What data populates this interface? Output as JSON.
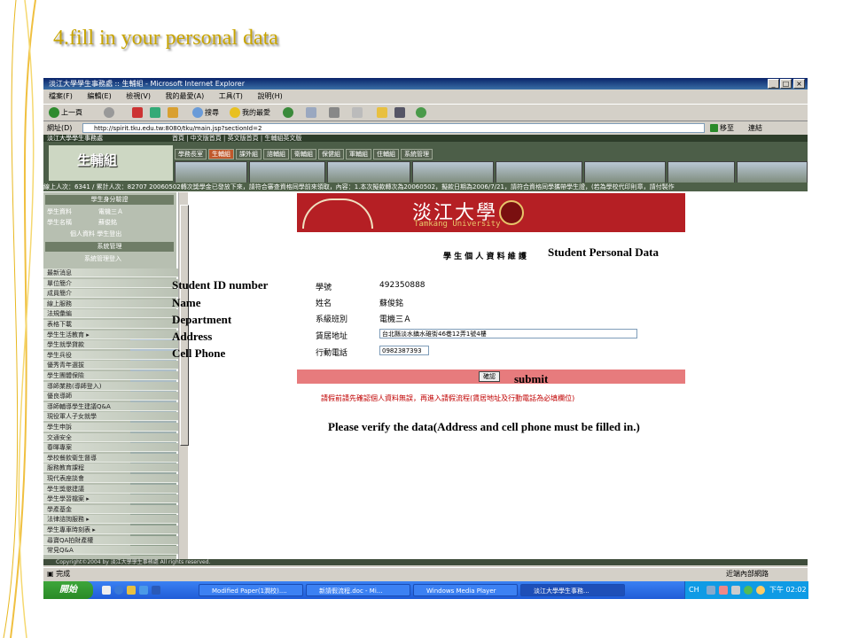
{
  "slide": {
    "title": "4.fill in your personal data"
  },
  "browser": {
    "window_title": "淡江大學學生事務處 :: 生輔組 - Microsoft Internet Explorer",
    "menu": [
      "檔案(F)",
      "編輯(E)",
      "檢視(V)",
      "我的最愛(A)",
      "工具(T)",
      "說明(H)"
    ],
    "toolbar": {
      "back": "上一頁",
      "search": "搜尋",
      "favorites": "我的最愛"
    },
    "address_label": "網址(D)",
    "url": "http://spirit.tku.edu.tw:8080/tku/main.jsp?sectionId=2",
    "go_label": "移至",
    "links_label": "連結",
    "status_left": "完成",
    "status_right": "近端內部網路"
  },
  "site": {
    "logo_text": "生輔組",
    "header_title": "淡江大學學生事務處",
    "nav_links": "首頁 | 中文版首頁 | 英文版首頁 | 生輔組英文版",
    "tabs": [
      "學務長室",
      "生輔組",
      "課外組",
      "諮輔組",
      "衛輔組",
      "保健組",
      "軍輔組",
      "住輔組",
      "系統管理"
    ],
    "ticker": "線上人次：6341 / 累計人次：82707    20060502轉次獎學金已發放下來，請符合審查資格同學前來領取，內容：1.本次擬款轉次為20060502，擬款日期為2006/7/21，請符合資格同學攜帶學生證，(若為學校代印則章，請付製作",
    "copyright": "Copyright©2004 by 淡江大學學生事務處 All rights reserved."
  },
  "sidebar": {
    "identity_header": "學生身分驗證",
    "student_info_label": "學生資料",
    "student_info_value": "電機三Ａ",
    "student_name_label": "學生名稱",
    "student_name_value": "蘇俊銘",
    "links": "個人資料 學生登出",
    "admin_header": "系統管理",
    "admin_link": "系統管理登入",
    "menu": [
      "最新消息",
      "單位簡介",
      "成員簡介",
      "線上服務",
      "法規彙編",
      "表格下載",
      "學生生活教育 ▸",
      "學生就學貸款",
      "學生兵役",
      "優秀青年選拔",
      "學生團體保險",
      "導師業務(導師登入)",
      "優良導師",
      "導師輔導學生建議Q&A",
      "現役軍人子女就學",
      "學生申訴",
      "交通安全",
      "春暉專案",
      "學校餐飲衛生督導",
      "服務教育課程",
      "現代表座談會",
      "學生獎懲建議",
      "學生學習檔案 ▸",
      "學產基金",
      "法律諮詢服務 ▸",
      "學生專車時刻表 ▸",
      "尋寶QA拍財產權",
      "常見Q&A"
    ]
  },
  "content": {
    "logo_cn": "淡江大學",
    "logo_en": "Tamkang University",
    "form_title_cn": "學 生 個 人 資 料 維 護",
    "fields": [
      {
        "label": "學號",
        "value": "492350888"
      },
      {
        "label": "姓名",
        "value": "蘇俊銘"
      },
      {
        "label": "系級班別",
        "value": "電機三Ａ"
      },
      {
        "label": "賃居地址",
        "value": "台北縣淡水鎮水碓街46巷12弄1號4樓"
      },
      {
        "label": "行動電話",
        "value": "0982387393"
      }
    ],
    "submit_label": "確認",
    "notice_cn": "請假前請先確認個人資料無誤，再進入請假流程(賃居地址及行動電話為必填欄位)"
  },
  "annotations": {
    "student_personal_data": "Student Personal Data",
    "student_id": "Student ID number",
    "name": "Name",
    "department": "Department",
    "address": "Address",
    "cell_phone": "Cell Phone",
    "submit": "submit",
    "verify_note": "Please verify the data(Address and cell phone must be filled in.)"
  },
  "taskbar": {
    "start": "開始",
    "items": [
      "Modified Paper(1潤校)....",
      "新請假流程.doc - Mi...",
      "Windows Media Player",
      "淡江大學學生事務..."
    ],
    "lang": "CH",
    "clock": "下午 02:02"
  },
  "colors": {
    "title_gold": "#c8a400",
    "tku_red": "#b51f24",
    "submit_bar": "#e77b7d",
    "notice_red": "#c00000"
  }
}
